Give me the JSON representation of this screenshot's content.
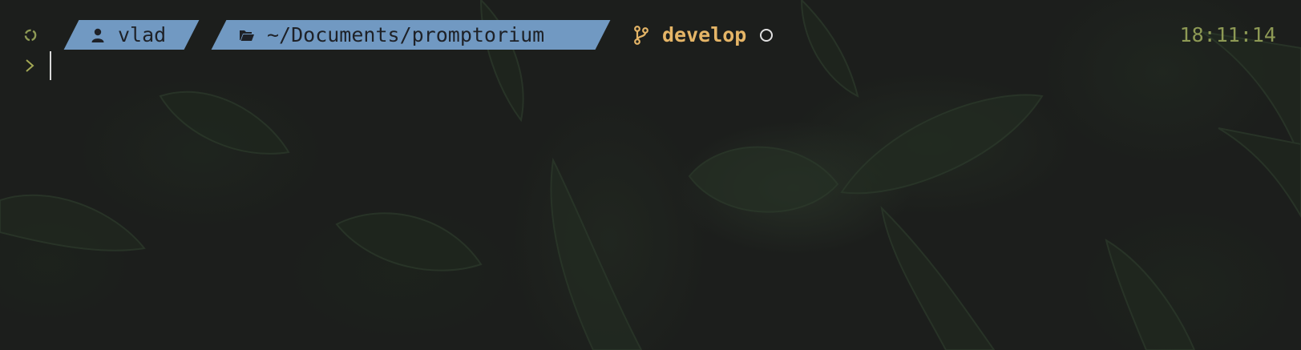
{
  "prompt": {
    "os_icon": "recycle-icon",
    "user_icon": "person-icon",
    "user": "vlad",
    "folder_icon": "open-folder-icon",
    "path": "~/Documents/promptorium",
    "git_icon": "git-branch-icon",
    "branch": "develop",
    "git_status_icon": "clean-circle-icon",
    "time": "18:11:14"
  },
  "input": {
    "prompt_symbol_icon": "chevron-right-icon",
    "command": ""
  },
  "colors": {
    "segment_bg": "#7199c2",
    "segment_text": "#1e2127",
    "git": "#e5b567",
    "clock": "#8e9a55",
    "prompt_symbol": "#a3a855",
    "background": "#1c1e1c"
  }
}
